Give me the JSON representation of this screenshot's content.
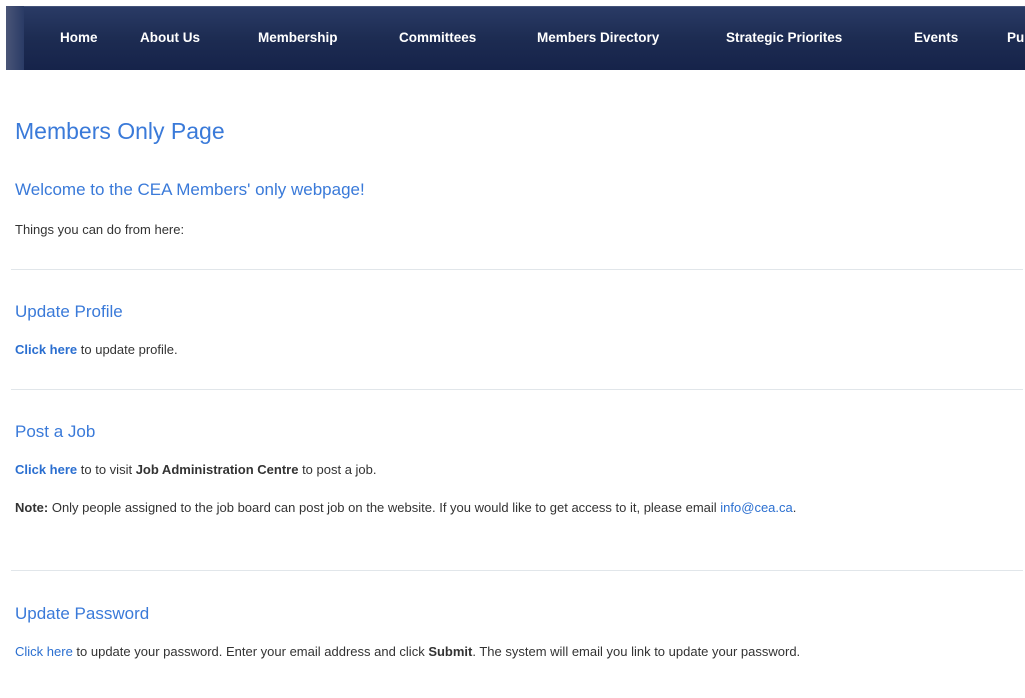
{
  "nav": {
    "items": [
      {
        "label": "Home"
      },
      {
        "label": "About Us"
      },
      {
        "label": "Membership"
      },
      {
        "label": "Committees"
      },
      {
        "label": "Members Directory"
      },
      {
        "label": "Strategic Priorites"
      },
      {
        "label": "Events"
      },
      {
        "label": "Pu"
      }
    ]
  },
  "page": {
    "title": "Members Only Page",
    "welcome": "Welcome to the CEA Members' only webpage!",
    "intro": "Things you can do from here:"
  },
  "sections": {
    "update_profile": {
      "title": "Update Profile",
      "link": "Click here",
      "text": " to update profile."
    },
    "post_job": {
      "title": "Post a Job",
      "link": "Click here",
      "text_before": " to to visit ",
      "bold": "Job Administration Centre",
      "text_after": " to post a job.",
      "note_label": "Note:",
      "note_text": " Only people assigned to the job board can post job on the website. If you would like to get access to it, please email ",
      "email": "info@cea.ca",
      "note_end": "."
    },
    "update_password": {
      "title": "Update Password",
      "link": "Click here",
      "text_before": " to update your password. Enter your email address and click ",
      "bold": "Submit",
      "text_after": ". The system will email you link to update your password."
    }
  },
  "colors": {
    "heading_blue": "#3a7ad9",
    "link_blue": "#2b6fd0",
    "nav_bg": "#1d2c52",
    "text": "#333333"
  }
}
